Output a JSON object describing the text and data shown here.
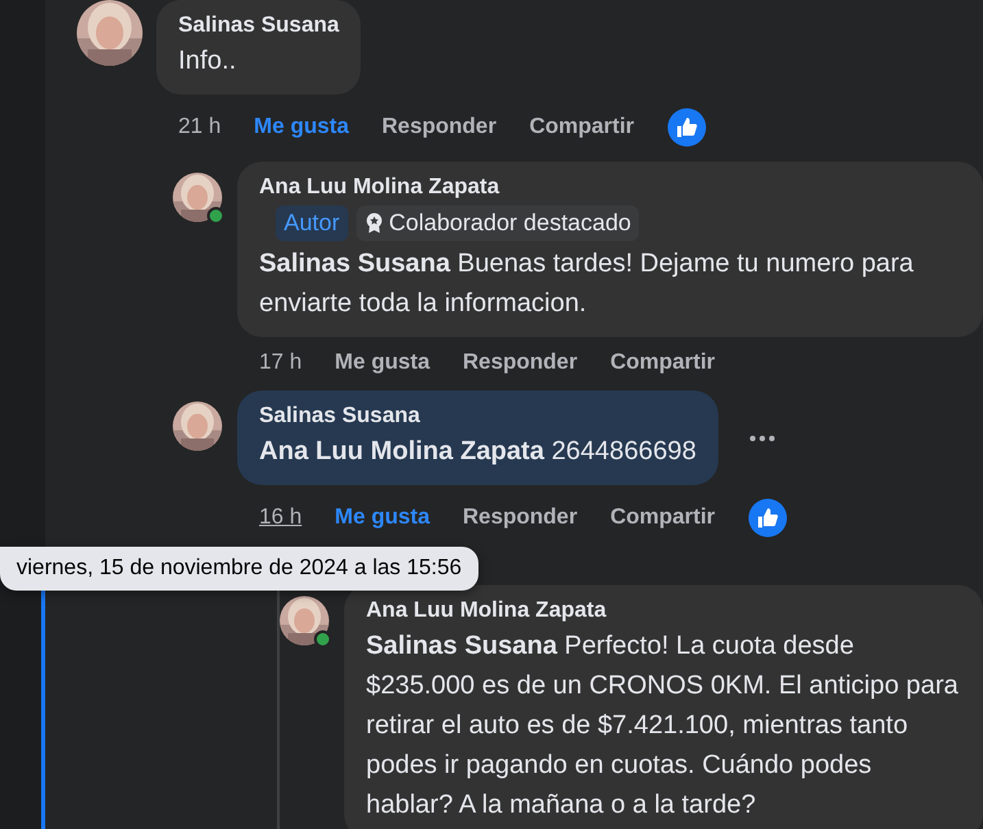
{
  "comments": [
    {
      "author": "Salinas Susana",
      "text": "Info..",
      "highlighted": false,
      "online": false,
      "time": "21 h",
      "time_hovered": false,
      "like_label": "Me gusta",
      "liked": true,
      "reply_label": "Responder",
      "share_label": "Compartir",
      "has_reaction": true,
      "more_menu": false,
      "children": [
        {
          "author": "Ana Luu Molina Zapata",
          "text": "**Salinas Susana** Buenas tardes! Dejame tu numero para enviarte toda la informacion.",
          "highlighted": false,
          "online": true,
          "time": "17 h",
          "time_hovered": false,
          "like_label": "Me gusta",
          "liked": false,
          "reply_label": "Responder",
          "share_label": "Compartir",
          "has_reaction": false,
          "more_menu": false,
          "badges": [
            {
              "kind": "author",
              "label": "Autor"
            },
            {
              "kind": "top_fan",
              "label": "Colaborador destacado"
            }
          ]
        },
        {
          "author": "Salinas Susana",
          "text": "**Ana Luu Molina Zapata** 2644866698",
          "highlighted": true,
          "online": false,
          "time": "16 h",
          "time_hovered": true,
          "like_label": "Me gusta",
          "liked": true,
          "reply_label": "Responder",
          "share_label": "Compartir",
          "has_reaction": true,
          "more_menu": true,
          "children": [
            {
              "author": "Ana Luu Molina Zapata",
              "text": "**Salinas Susana** Perfecto! La cuota desde $235.000 es de un CRONOS 0KM. El anticipo para retirar el auto es de $7.421.100, mientras tanto podes ir pagando en cuotas. Cuándo podes hablar? A la mañana o a la tarde?",
              "highlighted": false,
              "online": true,
              "more_menu": false
            }
          ]
        }
      ]
    }
  ],
  "tooltip": {
    "text": "viernes, 15 de noviembre de 2024 a las 15:56"
  }
}
